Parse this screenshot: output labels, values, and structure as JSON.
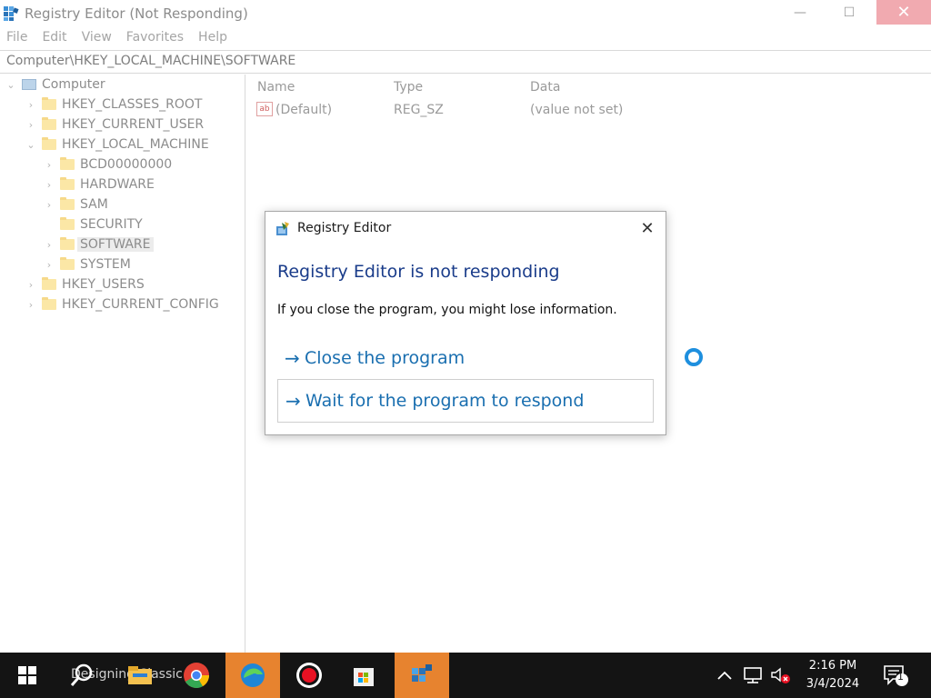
{
  "window": {
    "title": "Registry Editor (Not Responding)",
    "minimize": "—",
    "maximize": "☐",
    "close": "✕"
  },
  "menu": [
    "File",
    "Edit",
    "View",
    "Favorites",
    "Help"
  ],
  "address": "Computer\\HKEY_LOCAL_MACHINE\\SOFTWARE",
  "tree": [
    {
      "label": "Computer",
      "level": 0,
      "chevron": "⌄",
      "icon": "computer-icon"
    },
    {
      "label": "HKEY_CLASSES_ROOT",
      "level": 1,
      "chevron": "›",
      "icon": "folder-icon"
    },
    {
      "label": "HKEY_CURRENT_USER",
      "level": 1,
      "chevron": "›",
      "icon": "folder-icon"
    },
    {
      "label": "HKEY_LOCAL_MACHINE",
      "level": 1,
      "chevron": "⌄",
      "icon": "folder-icon"
    },
    {
      "label": "BCD00000000",
      "level": 2,
      "chevron": "›",
      "icon": "folder-icon"
    },
    {
      "label": "HARDWARE",
      "level": 2,
      "chevron": "›",
      "icon": "folder-icon"
    },
    {
      "label": "SAM",
      "level": 2,
      "chevron": "›",
      "icon": "folder-icon"
    },
    {
      "label": "SECURITY",
      "level": 2,
      "chevron": "",
      "icon": "folder-icon"
    },
    {
      "label": "SOFTWARE",
      "level": 2,
      "chevron": "›",
      "icon": "folder-icon",
      "selected": true
    },
    {
      "label": "SYSTEM",
      "level": 2,
      "chevron": "›",
      "icon": "folder-icon"
    },
    {
      "label": "HKEY_USERS",
      "level": 1,
      "chevron": "›",
      "icon": "folder-icon"
    },
    {
      "label": "HKEY_CURRENT_CONFIG",
      "level": 1,
      "chevron": "›",
      "icon": "folder-icon"
    }
  ],
  "values": {
    "columns": {
      "name": "Name",
      "type": "Type",
      "data": "Data"
    },
    "rows": [
      {
        "icon": "ab",
        "name": "(Default)",
        "type": "REG_SZ",
        "data": "(value not set)"
      }
    ]
  },
  "dialog": {
    "title": "Registry Editor",
    "heading": "Registry Editor is not responding",
    "message": "If you close the program, you might lose information.",
    "option_close": "Close the program",
    "option_wait": "Wait for the program to respond",
    "arrow": "→",
    "close_icon": "✕"
  },
  "taskbar": {
    "background_text": "Designing Classic M",
    "clock_time": "2:16 PM",
    "clock_date": "3/4/2024",
    "notification_count": "1"
  },
  "colors": {
    "taskbar": "#141414",
    "active_app": "#e7832f",
    "dialog_heading": "#1a3c8a",
    "link": "#1a6fb0"
  }
}
